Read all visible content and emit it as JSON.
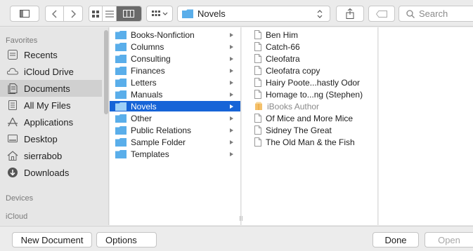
{
  "toolbar": {
    "path_label": "Novels",
    "search_placeholder": "Search"
  },
  "sidebar": {
    "favorites_header": "Favorites",
    "favorites": [
      {
        "label": "Recents",
        "icon": "recents-icon"
      },
      {
        "label": "iCloud Drive",
        "icon": "cloud-icon"
      },
      {
        "label": "Documents",
        "icon": "documents-icon",
        "selected": true
      },
      {
        "label": "All My Files",
        "icon": "all-files-icon"
      },
      {
        "label": "Applications",
        "icon": "applications-icon"
      },
      {
        "label": "Desktop",
        "icon": "desktop-icon"
      },
      {
        "label": "sierrabob",
        "icon": "home-icon"
      },
      {
        "label": "Downloads",
        "icon": "downloads-icon"
      }
    ],
    "devices_header": "Devices",
    "icloud_header": "iCloud"
  },
  "column1": {
    "items": [
      {
        "label": "Books-Nonfiction"
      },
      {
        "label": "Columns"
      },
      {
        "label": "Consulting"
      },
      {
        "label": "Finances"
      },
      {
        "label": "Letters"
      },
      {
        "label": "Manuals"
      },
      {
        "label": "Novels",
        "selected": true
      },
      {
        "label": "Other"
      },
      {
        "label": "Public Relations"
      },
      {
        "label": "Sample Folder"
      },
      {
        "label": "Templates"
      }
    ]
  },
  "column2": {
    "items": [
      {
        "label": "Ben Him",
        "icon": "document-icon"
      },
      {
        "label": "Catch-66",
        "icon": "document-icon"
      },
      {
        "label": "Cleofatra",
        "icon": "document-icon"
      },
      {
        "label": "Cleofatra copy",
        "icon": "document-icon"
      },
      {
        "label": "Hairy Poote...hastly Odor",
        "icon": "document-icon"
      },
      {
        "label": "Homage to...ng (Stephen)",
        "icon": "document-icon"
      },
      {
        "label": "iBooks Author",
        "icon": "ibooks-author-icon",
        "dim": true
      },
      {
        "label": "Of Mice and More Mice",
        "icon": "document-icon"
      },
      {
        "label": "Sidney The Great",
        "icon": "document-icon"
      },
      {
        "label": "The Old Man & the Fish",
        "icon": "document-icon"
      }
    ]
  },
  "bottombar": {
    "new_document": "New Document",
    "options": "Options",
    "done": "Done",
    "open": "Open"
  },
  "colors": {
    "selection": "#1764d7",
    "folder": "#5aaeea",
    "sidebar_selected": "#d0d0d0"
  }
}
